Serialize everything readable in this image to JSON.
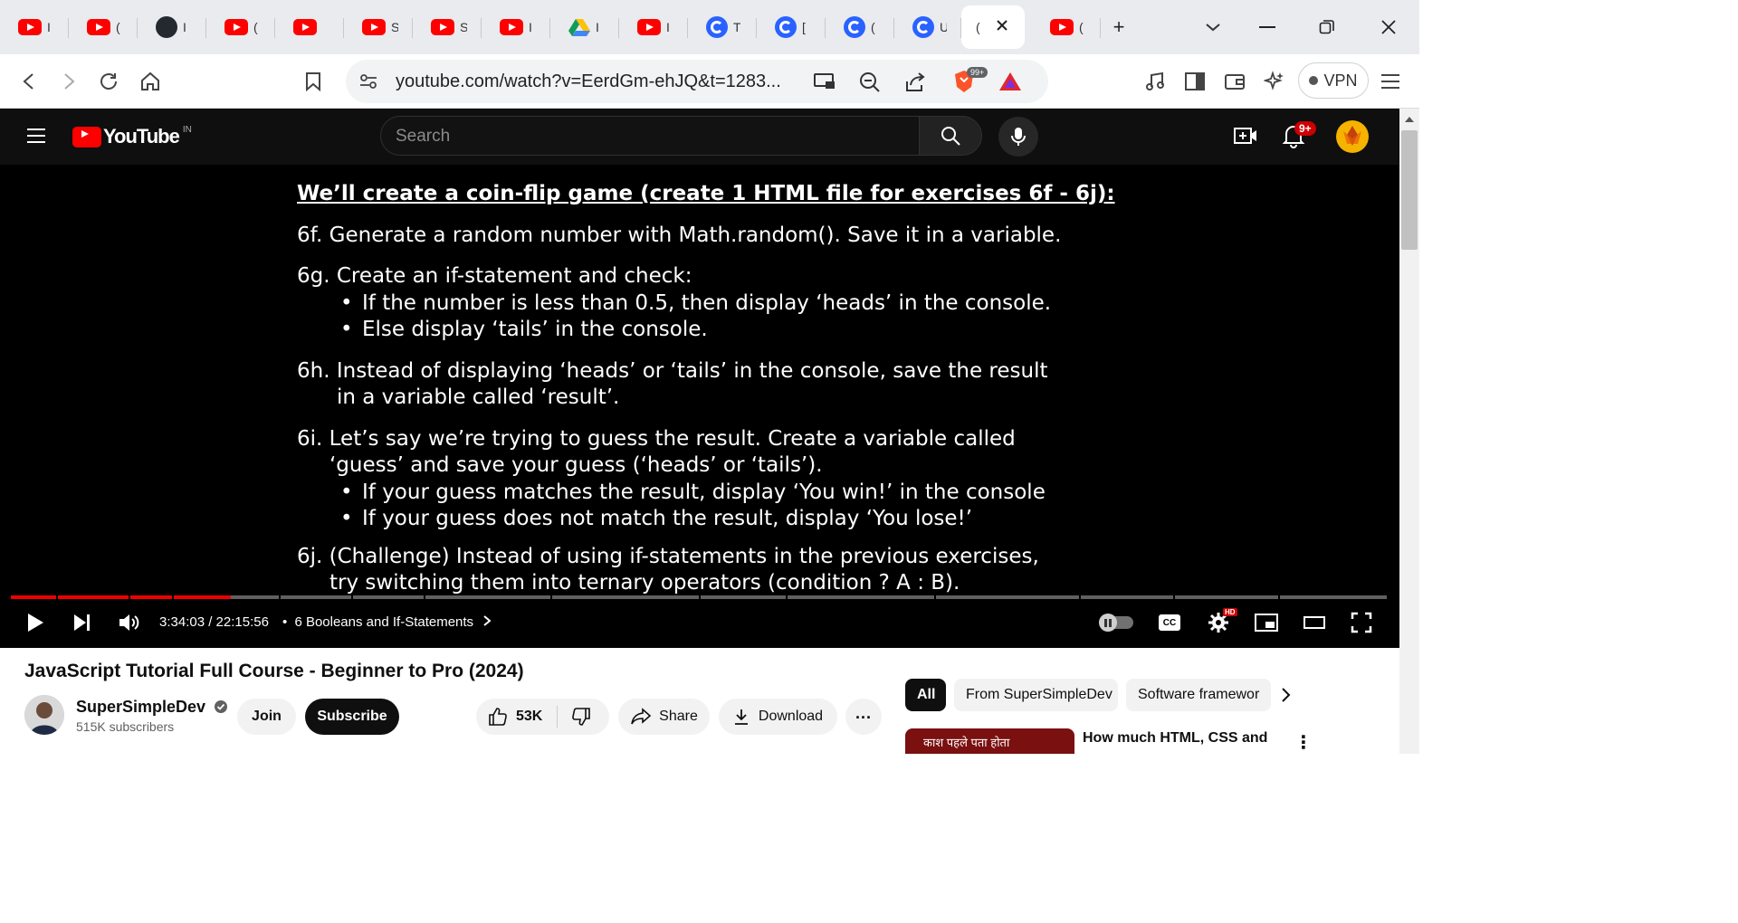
{
  "browser": {
    "tabs": [
      {
        "icon": "youtube-icon",
        "label": "I"
      },
      {
        "icon": "youtube-icon",
        "label": "("
      },
      {
        "icon": "github-icon",
        "label": "I"
      },
      {
        "icon": "youtube-icon",
        "label": "("
      },
      {
        "icon": "youtube-icon",
        "label": ""
      },
      {
        "icon": "youtube-icon",
        "label": "S"
      },
      {
        "icon": "youtube-icon",
        "label": "S"
      },
      {
        "icon": "youtube-icon",
        "label": "I"
      },
      {
        "icon": "google-drive-icon",
        "label": "I"
      },
      {
        "icon": "youtube-icon",
        "label": "I"
      },
      {
        "icon": "chromatic-icon",
        "label": "T"
      },
      {
        "icon": "chromatic-icon",
        "label": "["
      },
      {
        "icon": "chromatic-icon",
        "label": "("
      },
      {
        "icon": "chromatic-icon",
        "label": "U"
      },
      {
        "icon": "none",
        "label": "(",
        "active": true
      },
      {
        "icon": "youtube-icon",
        "label": "("
      }
    ],
    "new_tab_label": "+",
    "url": "youtube.com/watch?v=EerdGm-ehJQ&t=1283...",
    "shields_badge": "99+",
    "vpn_label": "VPN"
  },
  "youtube": {
    "logo_text": "YouTube",
    "region": "IN",
    "search_placeholder": "Search",
    "notification_badge": "9+"
  },
  "slide": {
    "title": "We’ll create a coin-flip game (create 1 HTML file for exercises 6f - 6j):",
    "f": "6f. Generate a random number with Math.random(). Save it in a variable.",
    "g_head": "6g. Create an if-statement and check:",
    "g_b1": "If the number is less than 0.5, then display ‘heads’ in the console.",
    "g_b2": "Else display ‘tails’ in the console.",
    "h_1": "6h. Instead of displaying ‘heads’ or ‘tails’ in the console, save the result",
    "h_2": "in a variable called ‘result’.",
    "i_1": "6i. Let’s say we’re trying to guess the result. Create a variable called",
    "i_2": "‘guess’ and save your guess (‘heads’ or ‘tails’).",
    "i_b1": "If your guess matches the result, display ‘You win!’ in the console",
    "i_b2": "If your guess does not match the result, display ‘You lose!’",
    "j_1": "6j. (Challenge) Instead of using if-statements in the previous exercises,",
    "j_2": "try switching them into ternary operators (condition ? A : B)."
  },
  "player": {
    "time": "3:34:03 / 22:15:56",
    "chapter_sep": "•",
    "chapter": "6 Booleans and If-Statements",
    "progress_fraction": 0.16,
    "hd_badge": "HD",
    "cc_label": "CC"
  },
  "video": {
    "title": "JavaScript Tutorial Full Course - Beginner to Pro (2024)",
    "channel": "SuperSimpleDev",
    "subscribers": "515K subscribers",
    "join_label": "Join",
    "subscribe_label": "Subscribe",
    "likes": "53K",
    "share_label": "Share",
    "download_label": "Download",
    "more_label": "..."
  },
  "sidebar": {
    "chips": [
      "All",
      "From SuperSimpleDev",
      "Software framewor"
    ],
    "rec_thumb_text": "काश पहले पता होता",
    "rec_title": "How much HTML, CSS and"
  },
  "colors": {
    "accent": "#ff0000",
    "dark": "#0f0f0f",
    "badge": "#cc0000"
  }
}
